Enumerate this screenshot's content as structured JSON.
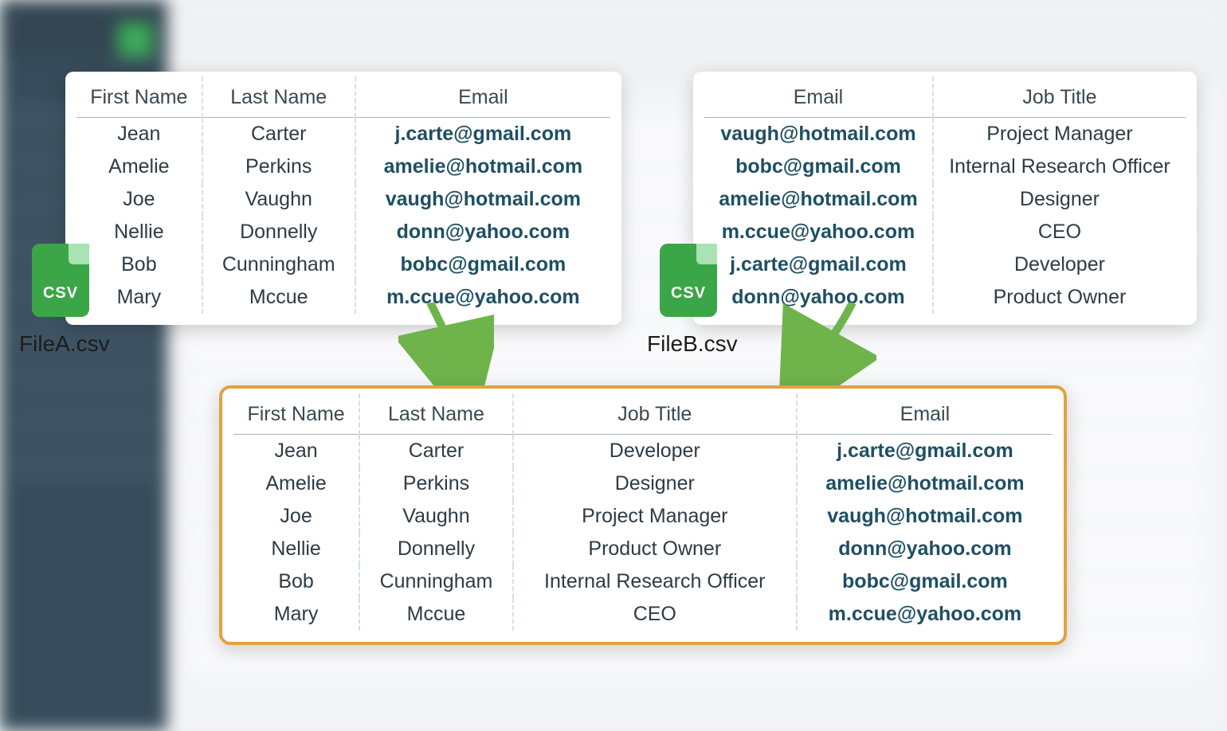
{
  "files": {
    "a": {
      "label": "FileA.csv",
      "icon_text": "CSV"
    },
    "b": {
      "label": "FileB.csv",
      "icon_text": "CSV"
    }
  },
  "tableA": {
    "headers": [
      "First Name",
      "Last Name",
      "Email"
    ],
    "rows": [
      {
        "first": "Jean",
        "last": "Carter",
        "email": "j.carte@gmail.com"
      },
      {
        "first": "Amelie",
        "last": "Perkins",
        "email": "amelie@hotmail.com"
      },
      {
        "first": "Joe",
        "last": "Vaughn",
        "email": "vaugh@hotmail.com"
      },
      {
        "first": "Nellie",
        "last": "Donnelly",
        "email": "donn@yahoo.com"
      },
      {
        "first": "Bob",
        "last": "Cunningham",
        "email": "bobc@gmail.com"
      },
      {
        "first": "Mary",
        "last": "Mccue",
        "email": "m.ccue@yahoo.com"
      }
    ]
  },
  "tableB": {
    "headers": [
      "Email",
      "Job Title"
    ],
    "rows": [
      {
        "email": "vaugh@hotmail.com",
        "job": "Project Manager"
      },
      {
        "email": "bobc@gmail.com",
        "job": "Internal Research Officer"
      },
      {
        "email": "amelie@hotmail.com",
        "job": "Designer"
      },
      {
        "email": "m.ccue@yahoo.com",
        "job": "CEO"
      },
      {
        "email": "j.carte@gmail.com",
        "job": "Developer"
      },
      {
        "email": "donn@yahoo.com",
        "job": "Product Owner"
      }
    ]
  },
  "merged": {
    "headers": [
      "First Name",
      "Last Name",
      "Job Title",
      "Email"
    ],
    "rows": [
      {
        "first": "Jean",
        "last": "Carter",
        "job": "Developer",
        "email": "j.carte@gmail.com"
      },
      {
        "first": "Amelie",
        "last": "Perkins",
        "job": "Designer",
        "email": "amelie@hotmail.com"
      },
      {
        "first": "Joe",
        "last": "Vaughn",
        "job": "Project Manager",
        "email": "vaugh@hotmail.com"
      },
      {
        "first": "Nellie",
        "last": "Donnelly",
        "job": "Product Owner",
        "email": "donn@yahoo.com"
      },
      {
        "first": "Bob",
        "last": "Cunningham",
        "job": "Internal Research Officer",
        "email": "bobc@gmail.com"
      },
      {
        "first": "Mary",
        "last": "Mccue",
        "job": "CEO",
        "email": "m.ccue@yahoo.com"
      }
    ]
  }
}
